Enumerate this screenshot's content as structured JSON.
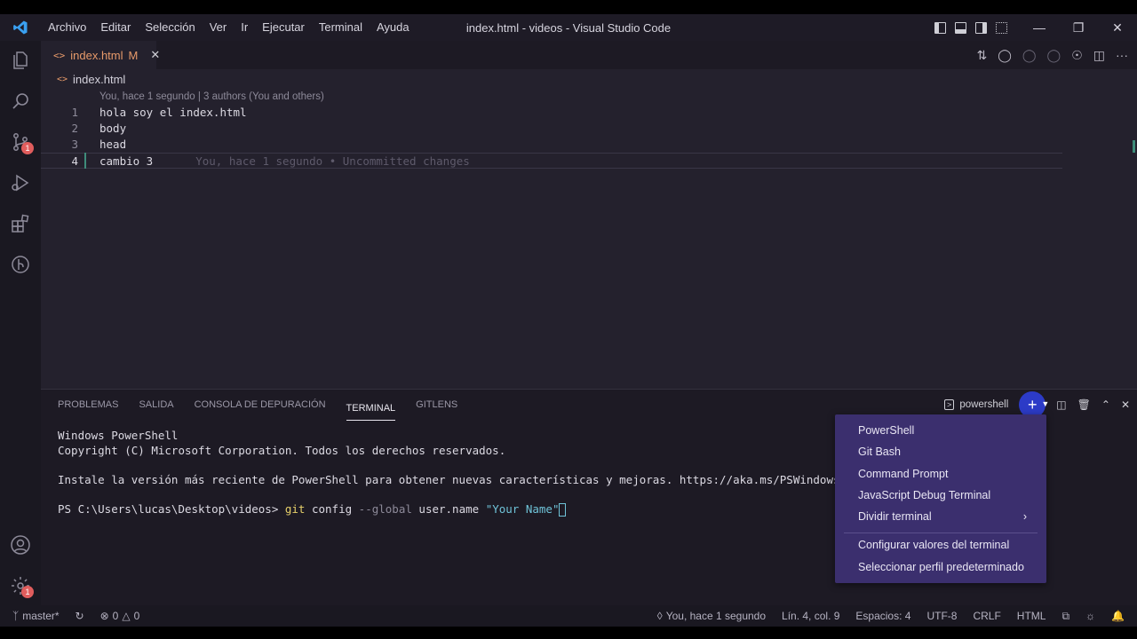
{
  "window": {
    "title": "index.html - videos - Visual Studio Code"
  },
  "menu": [
    "Archivo",
    "Editar",
    "Selección",
    "Ver",
    "Ir",
    "Ejecutar",
    "Terminal",
    "Ayuda"
  ],
  "activity": {
    "scm_badge": "1",
    "manage_badge": "1"
  },
  "tab": {
    "filename": "index.html",
    "status": "M"
  },
  "breadcrumb": {
    "file": "index.html"
  },
  "codelens": "You, hace 1 segundo | 3 authors (You and others)",
  "editor": {
    "lines": [
      {
        "num": "1",
        "text": "hola soy el index.html"
      },
      {
        "num": "2",
        "text": "body"
      },
      {
        "num": "3",
        "text": "head"
      },
      {
        "num": "4",
        "text": "cambio 3"
      }
    ],
    "blame": "You, hace 1 segundo • Uncommitted changes"
  },
  "panel": {
    "tabs": [
      "PROBLEMAS",
      "SALIDA",
      "CONSOLA DE DEPURACIÓN",
      "TERMINAL",
      "GITLENS"
    ],
    "active_tab": "TERMINAL",
    "terminal_name": "powershell"
  },
  "terminal": {
    "line1": "Windows PowerShell",
    "line2": "Copyright (C) Microsoft Corporation. Todos los derechos reservados.",
    "line3": "Instale la versión más reciente de PowerShell para obtener nuevas características y mejoras. https://aka.ms/PSWindows",
    "prompt": "PS C:\\Users\\lucas\\Desktop\\videos> ",
    "cmd": "git",
    "arg1": " config ",
    "flag": "--global",
    "arg2": " user.name ",
    "str": "\"Your Name\""
  },
  "dropdown": {
    "items": [
      "PowerShell",
      "Git Bash",
      "Command Prompt",
      "JavaScript Debug Terminal",
      "Dividir terminal"
    ],
    "items2": [
      "Configurar valores del terminal",
      "Seleccionar perfil predeterminado"
    ]
  },
  "statusbar": {
    "branch": "master*",
    "errors": "0",
    "warnings": "0",
    "blame": "You, hace 1 segundo",
    "position": "Lín. 4, col. 9",
    "spaces": "Espacios: 4",
    "encoding": "UTF-8",
    "eol": "CRLF",
    "language": "HTML"
  },
  "colors": {
    "accent": "#2c3bc7",
    "dropdown_bg": "#3b2f6e",
    "editor_bg": "#24212d",
    "badge": "#e05d5d"
  }
}
